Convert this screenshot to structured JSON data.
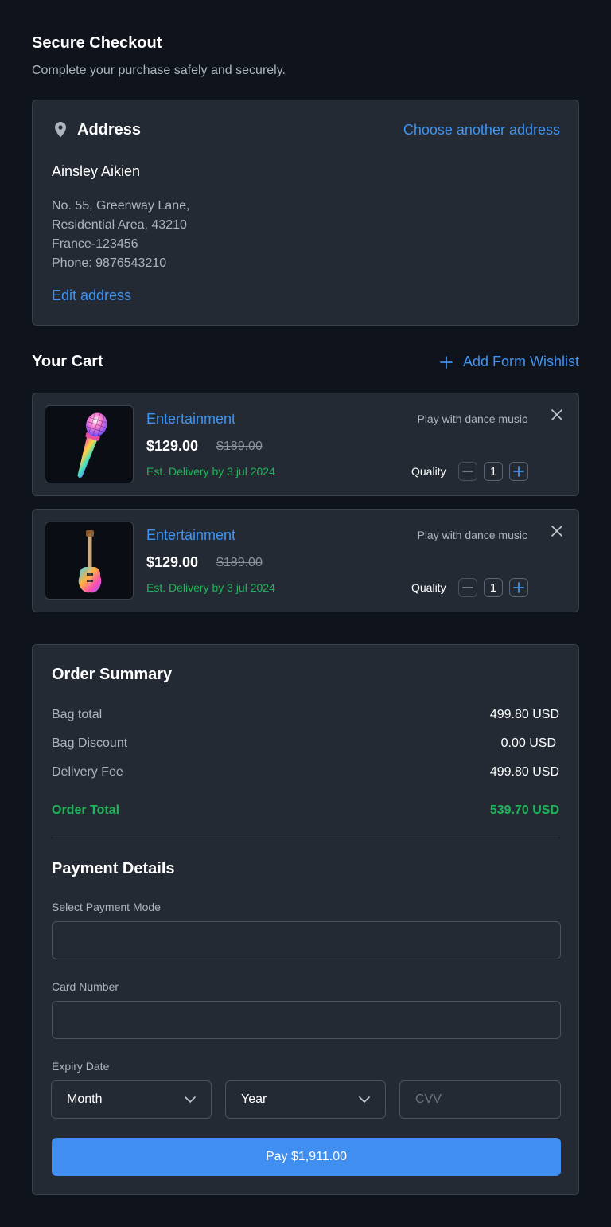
{
  "header": {
    "title": "Secure Checkout",
    "subtitle": "Complete your purchase safely and securely."
  },
  "address": {
    "heading": "Address",
    "icon": "map-pin-icon",
    "choose_link": "Choose another address",
    "name": "Ainsley Aikien",
    "lines": [
      "No. 55, Greenway Lane,",
      "Residential Area, 43210",
      "France-123456",
      "Phone: 9876543210"
    ],
    "edit_link": "Edit address"
  },
  "cart": {
    "heading": "Your Cart",
    "wishlist_label": "Add Form Wishlist",
    "quantity_label": "Quality",
    "items": [
      {
        "category": "Entertainment",
        "price": "$129.00",
        "old_price": "$189.00",
        "delivery": "Est. Delivery by 3 jul 2024",
        "description": "Play with dance music",
        "quantity": "1",
        "image": "microphone-image"
      },
      {
        "category": "Entertainment",
        "price": "$129.00",
        "old_price": "$189.00",
        "delivery": "Est. Delivery by 3 jul 2024",
        "description": "Play with dance music",
        "quantity": "1",
        "image": "guitar-image"
      }
    ]
  },
  "summary": {
    "title": "Order Summary",
    "rows": [
      {
        "label": "Bag total",
        "value": "499.80 USD"
      },
      {
        "label": "Bag Discount",
        "value": "0.00 USD"
      },
      {
        "label": "Delivery Fee",
        "value": "499.80 USD"
      }
    ],
    "total": {
      "label": "Order Total",
      "value": "539.70 USD"
    }
  },
  "payment": {
    "title": "Payment Details",
    "mode_label": "Select Payment Mode",
    "mode_value": "",
    "card_label": "Card Number",
    "card_value": "",
    "expiry_label": "Expiry Date",
    "month_value": "Month",
    "year_value": "Year",
    "cvv_placeholder": "CVV",
    "pay_button": "Pay $1,911.00"
  },
  "colors": {
    "background": "#0e131c",
    "card": "#232a33",
    "accent": "#3f93f2",
    "success": "#22b35a",
    "button": "#3f8ef0"
  }
}
